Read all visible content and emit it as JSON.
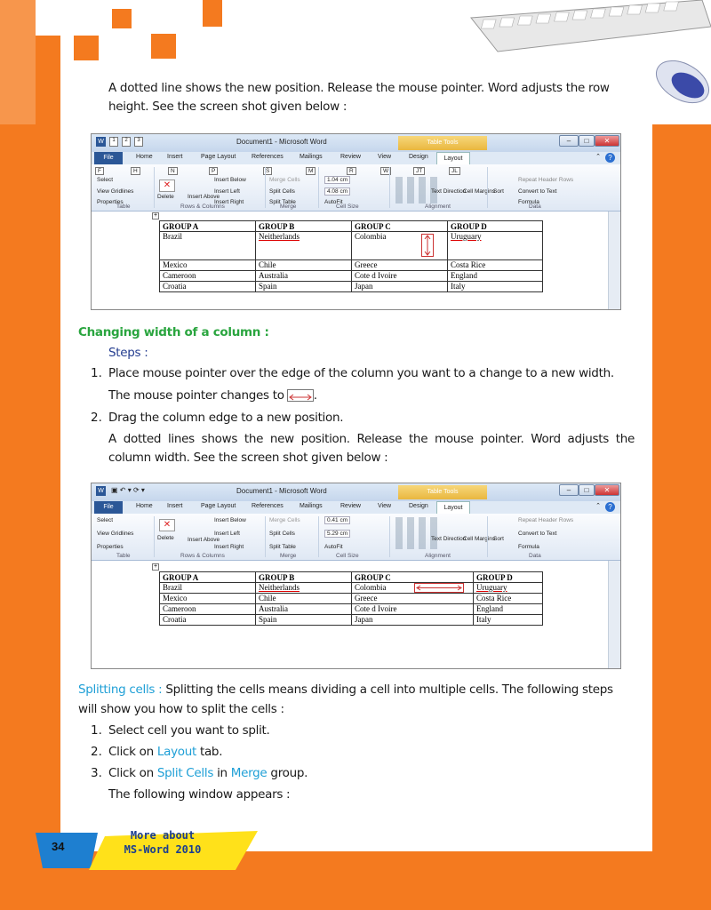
{
  "para1": [
    "A dotted line shows the new position. Release the mouse pointer. Word adjusts the row",
    "height. See the screen shot given below :"
  ],
  "shot": {
    "title": "Document1 - Microsoft Word",
    "table_tools": "Table Tools",
    "tabs": [
      "File",
      "Home",
      "Insert",
      "Page Layout",
      "References",
      "Mailings",
      "Review",
      "View",
      "Design",
      "Layout"
    ],
    "keytips": [
      "F",
      "H",
      "N",
      "P",
      "S",
      "M",
      "R",
      "W",
      "JT",
      "JL"
    ],
    "ribbon": {
      "select": "Select",
      "view_gridlines": "View Gridlines",
      "properties": "Properties",
      "delete": "Delete",
      "insert_above": "Insert Above",
      "insert_below": "Insert Below",
      "insert_left": "Insert Left",
      "insert_right": "Insert Right",
      "merge_cells": "Merge Cells",
      "split_cells": "Split Cells",
      "split_table": "Split Table",
      "autofit": "AutoFit",
      "text_direction": "Text Direction",
      "cell_margins": "Cell Margins",
      "sort": "Sort",
      "repeat_header": "Repeat Header Rows",
      "convert_text": "Convert to Text",
      "formula": "Formula",
      "groups": [
        "Table",
        "Rows & Columns",
        "Merge",
        "Cell Size",
        "Alignment",
        "Data"
      ]
    },
    "shot1_height": "1.04 cm",
    "shot1_width": "4.08 cm",
    "shot2_height": "0.41 cm",
    "shot2_width": "5.29 cm"
  },
  "word_table": {
    "headers": [
      "GROUP A",
      "GROUP B",
      "GROUP C",
      "GROUP D"
    ],
    "rows": [
      [
        "Brazil",
        "Neitherlands",
        "Colombia",
        "Uruguary"
      ],
      [
        "Mexico",
        "Chile",
        "Greece",
        "Costa Rice"
      ],
      [
        "Cameroon",
        "Australia",
        "Cote d Ivoire",
        "England"
      ],
      [
        "Croatia",
        "Spain",
        "Japan",
        "Italy"
      ]
    ]
  },
  "section_width": {
    "heading": "Changing width of a column :",
    "steps_label": "Steps :",
    "step1": "Place mouse pointer over the edge of the column you want to a change to a new width.",
    "step1b": "The mouse pointer changes to",
    "step2": "Drag the column edge to a new position.",
    "step2b": [
      "A dotted lines shows the new position. Release the mouse pointer. Word adjusts the",
      "column width. See the screen shot given below :"
    ]
  },
  "section_split": {
    "heading": "Splitting cells :",
    "intro": " Splitting the cells means dividing a cell into multiple cells. The following steps",
    "intro2": "will show you how to split the cells :",
    "step1": "Select cell you want to split.",
    "step2_pre": "Click on ",
    "step2_hl": "Layout",
    "step2_post": " tab.",
    "step3_pre": "Click on ",
    "step3_hl1": "Split Cells",
    "step3_mid": " in ",
    "step3_hl2": "Merge",
    "step3_post": " group.",
    "step3b": "The following window appears :"
  },
  "numbers": [
    "1.",
    "2.",
    "3."
  ],
  "footer": {
    "page": "34",
    "book_line1": "More about",
    "book_line2": "MS-Word 2010"
  }
}
